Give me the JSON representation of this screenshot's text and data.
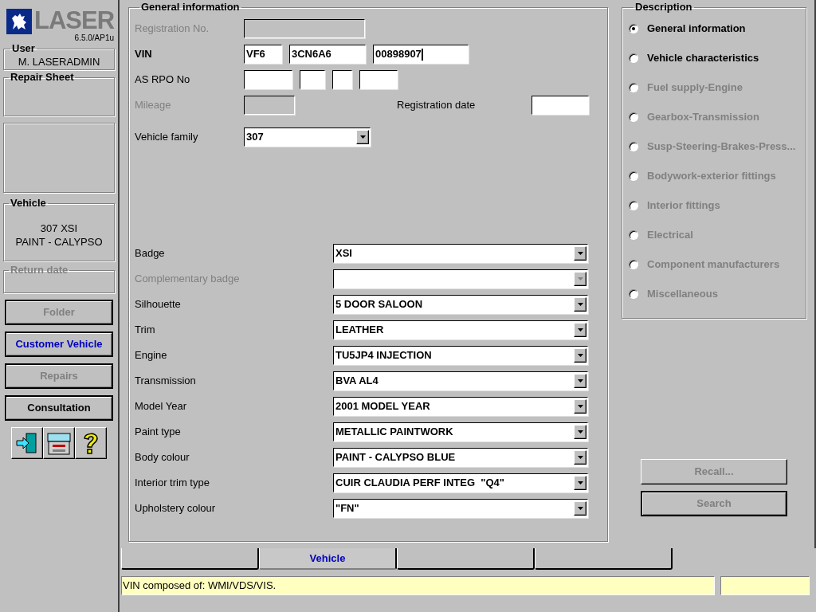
{
  "logo": {
    "name": "LASER",
    "version": "6.5.0/AP1u"
  },
  "sidebar": {
    "user": {
      "label": "User",
      "value": "M. LASERADMIN"
    },
    "repair_sheet": {
      "label": "Repair Sheet"
    },
    "vehicle": {
      "label": "Vehicle",
      "lines": [
        "307 XSI",
        "PAINT - CALYPSO"
      ]
    },
    "return_date": {
      "label": "Return date",
      "disabled": true
    },
    "buttons": [
      {
        "label": "Folder",
        "disabled": true,
        "selected": false
      },
      {
        "label": "Customer Vehicle",
        "disabled": false,
        "selected": true
      },
      {
        "label": "Repairs",
        "disabled": true,
        "selected": false
      },
      {
        "label": "Consultation",
        "disabled": false,
        "selected": false
      }
    ]
  },
  "general_information": {
    "title": "General information",
    "fields": [
      {
        "label": "Registration No.",
        "disabled": true,
        "bold": false,
        "inputs": [
          {
            "disabled": true,
            "focused": false
          }
        ]
      },
      {
        "label": "VIN",
        "disabled": false,
        "bold": true,
        "inputs": [
          {
            "value": "VF6",
            "disabled": false,
            "focused": false
          },
          {
            "value": "3CN6A6",
            "disabled": false,
            "focused": false
          },
          {
            "value": "00898907",
            "disabled": false,
            "focused": true
          }
        ]
      },
      {
        "label": "AS RPO No",
        "disabled": false,
        "bold": false,
        "inputs": [
          {
            "disabled": false,
            "focused": false
          },
          {
            "disabled": false,
            "focused": false
          },
          {
            "disabled": false,
            "focused": false
          },
          {
            "disabled": false,
            "focused": false
          }
        ]
      },
      {
        "label": "Mileage",
        "disabled": true,
        "bold": false,
        "inputs": [
          {
            "disabled": true,
            "focused": false
          }
        ],
        "side_label": "Registration date"
      }
    ],
    "vehicle_family": {
      "label": "Vehicle family",
      "value": "307"
    },
    "dropdowns": [
      {
        "label": "Badge",
        "value": "XSI",
        "disabled": false
      },
      {
        "label": "Complementary badge",
        "disabled": true
      },
      {
        "label": "Silhouette",
        "value": "5 DOOR SALOON",
        "disabled": false
      },
      {
        "label": "Trim",
        "value": "LEATHER",
        "disabled": false
      },
      {
        "label": "Engine",
        "value": "TU5JP4 INJECTION",
        "disabled": false
      },
      {
        "label": "Transmission",
        "value": "BVA AL4",
        "disabled": false
      },
      {
        "label": "Model Year",
        "value": "2001 MODEL YEAR",
        "disabled": false
      },
      {
        "label": "Paint type",
        "value": "METALLIC PAINTWORK",
        "disabled": false
      },
      {
        "label": "Body colour",
        "value": "PAINT - CALYPSO BLUE",
        "disabled": false
      },
      {
        "label": "Interior trim type",
        "value": "CUIR CLAUDIA PERF INTEG  \"Q4\"",
        "disabled": false
      },
      {
        "label": "Upholstery colour",
        "value": "\"FN\"",
        "disabled": false
      }
    ]
  },
  "description": {
    "title": "Description",
    "options": [
      {
        "label": "General information",
        "selected": true,
        "disabled": false
      },
      {
        "label": "Vehicle characteristics",
        "selected": false,
        "disabled": false
      },
      {
        "label": "Fuel supply-Engine",
        "selected": false,
        "disabled": true
      },
      {
        "label": "Gearbox-Transmission",
        "selected": false,
        "disabled": true
      },
      {
        "label": "Susp-Steering-Brakes-Press...",
        "selected": false,
        "disabled": true
      },
      {
        "label": "Bodywork-exterior fittings",
        "selected": false,
        "disabled": true
      },
      {
        "label": "Interior fittings",
        "selected": false,
        "disabled": true
      },
      {
        "label": "Electrical",
        "selected": false,
        "disabled": true
      },
      {
        "label": "Component manufacturers",
        "selected": false,
        "disabled": true
      },
      {
        "label": "Miscellaneous",
        "selected": false,
        "disabled": true
      }
    ]
  },
  "action_buttons": [
    {
      "label": "Recall...",
      "disabled": true,
      "default": false
    },
    {
      "label": "Search",
      "disabled": true,
      "default": true
    }
  ],
  "tabs": [
    {
      "selected": false
    },
    {
      "label": "Vehicle",
      "selected": true
    },
    {
      "selected": false
    },
    {
      "selected": false
    }
  ],
  "status_bar": {
    "message": "VIN composed of: WMI/VDS/VIS."
  }
}
